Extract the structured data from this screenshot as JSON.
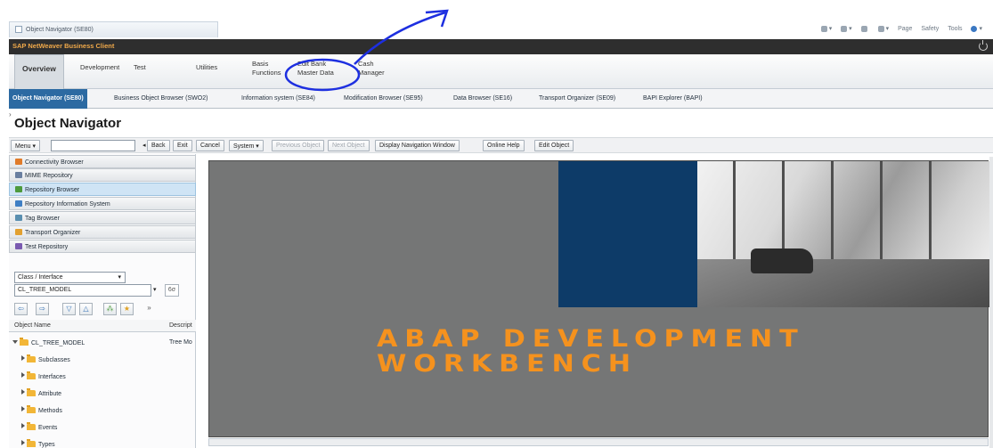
{
  "browser": {
    "tab_title": "Object Navigator (SE80)",
    "commands": [
      "Page",
      "Safety",
      "Tools"
    ]
  },
  "nwbc": {
    "title": "SAP NetWeaver Business Client"
  },
  "work_centers": [
    {
      "label": "Overview"
    },
    {
      "label": "Development"
    },
    {
      "label": "Test"
    },
    {
      "label": "Utilities"
    },
    {
      "label": "Basis\nFunctions"
    },
    {
      "label": "Edit Bank\nMaster Data"
    },
    {
      "label": "Cash\nManager"
    }
  ],
  "tabs": [
    {
      "label": "Object Navigator (SE80)"
    },
    {
      "label": "Business Object Browser (SWO2)"
    },
    {
      "label": "Information system (SE84)"
    },
    {
      "label": "Modification Browser (SE95)"
    },
    {
      "label": "Data Browser (SE16)"
    },
    {
      "label": "Transport Organizer (SE09)"
    },
    {
      "label": "BAPI Explorer (BAPI)"
    }
  ],
  "page": {
    "title": "Object Navigator"
  },
  "toolbar": {
    "menu": "Menu",
    "input_value": "",
    "back": "Back",
    "exit": "Exit",
    "cancel": "Cancel",
    "system": "System",
    "previous_object": "Previous Object",
    "next_object": "Next Object",
    "display_nav": "Display Navigation Window",
    "online_help": "Online Help",
    "edit_object": "Edit Object"
  },
  "nav_items": [
    {
      "label": "Connectivity Browser",
      "color": "#e07b2a"
    },
    {
      "label": "MIME Repository",
      "color": "#6a7fa0"
    },
    {
      "label": "Repository Browser",
      "color": "#4d9a3d"
    },
    {
      "label": "Repository Information System",
      "color": "#3f7fc4"
    },
    {
      "label": "Tag Browser",
      "color": "#5a8fb0"
    },
    {
      "label": "Transport Organizer",
      "color": "#e2a030"
    },
    {
      "label": "Test Repository",
      "color": "#7a5ab0"
    }
  ],
  "object_select": {
    "type": "Class / Interface",
    "name": "CL_TREE_MODEL"
  },
  "tree": {
    "col_name": "Object Name",
    "col_desc": "Descript",
    "root": {
      "label": "CL_TREE_MODEL",
      "desc": "Tree Mo"
    },
    "children": [
      "Subclasses",
      "Interfaces",
      "Attribute",
      "Methods",
      "Events",
      "Types"
    ]
  },
  "splash": {
    "line1": "ABAP DEVELOPMENT",
    "line2": "WORKBENCH",
    "title_color": "#f5921e"
  }
}
